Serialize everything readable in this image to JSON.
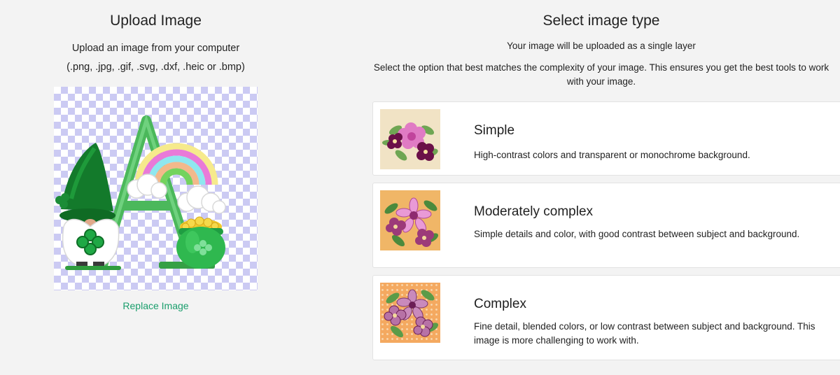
{
  "upload": {
    "title": "Upload Image",
    "subtitle": "Upload an image from your computer",
    "formats": "(.png, .jpg, .gif, .svg, .dxf, .heic or .bmp)",
    "replace_label": "Replace Image"
  },
  "select_type": {
    "title": "Select image type",
    "subtitle": "Your image will be uploaded as a single layer",
    "instruction": "Select the option that best matches the complexity of your image. This ensures you get the best tools to work with your image.",
    "options": [
      {
        "name": "Simple",
        "description": "High-contrast colors and transparent or monochrome background.",
        "thumb_bg": "#f1e3c5"
      },
      {
        "name": "Moderately complex",
        "description": "Simple details and color, with good contrast between subject and background.",
        "thumb_bg": "#f0b667"
      },
      {
        "name": "Complex",
        "description": "Fine detail, blended colors, or low contrast between subject and background. This image is more challenging to work with.",
        "thumb_bg": "#f4a960"
      }
    ]
  },
  "colors": {
    "accent": "#1a9e6c",
    "checker": "#cbcaf3"
  }
}
